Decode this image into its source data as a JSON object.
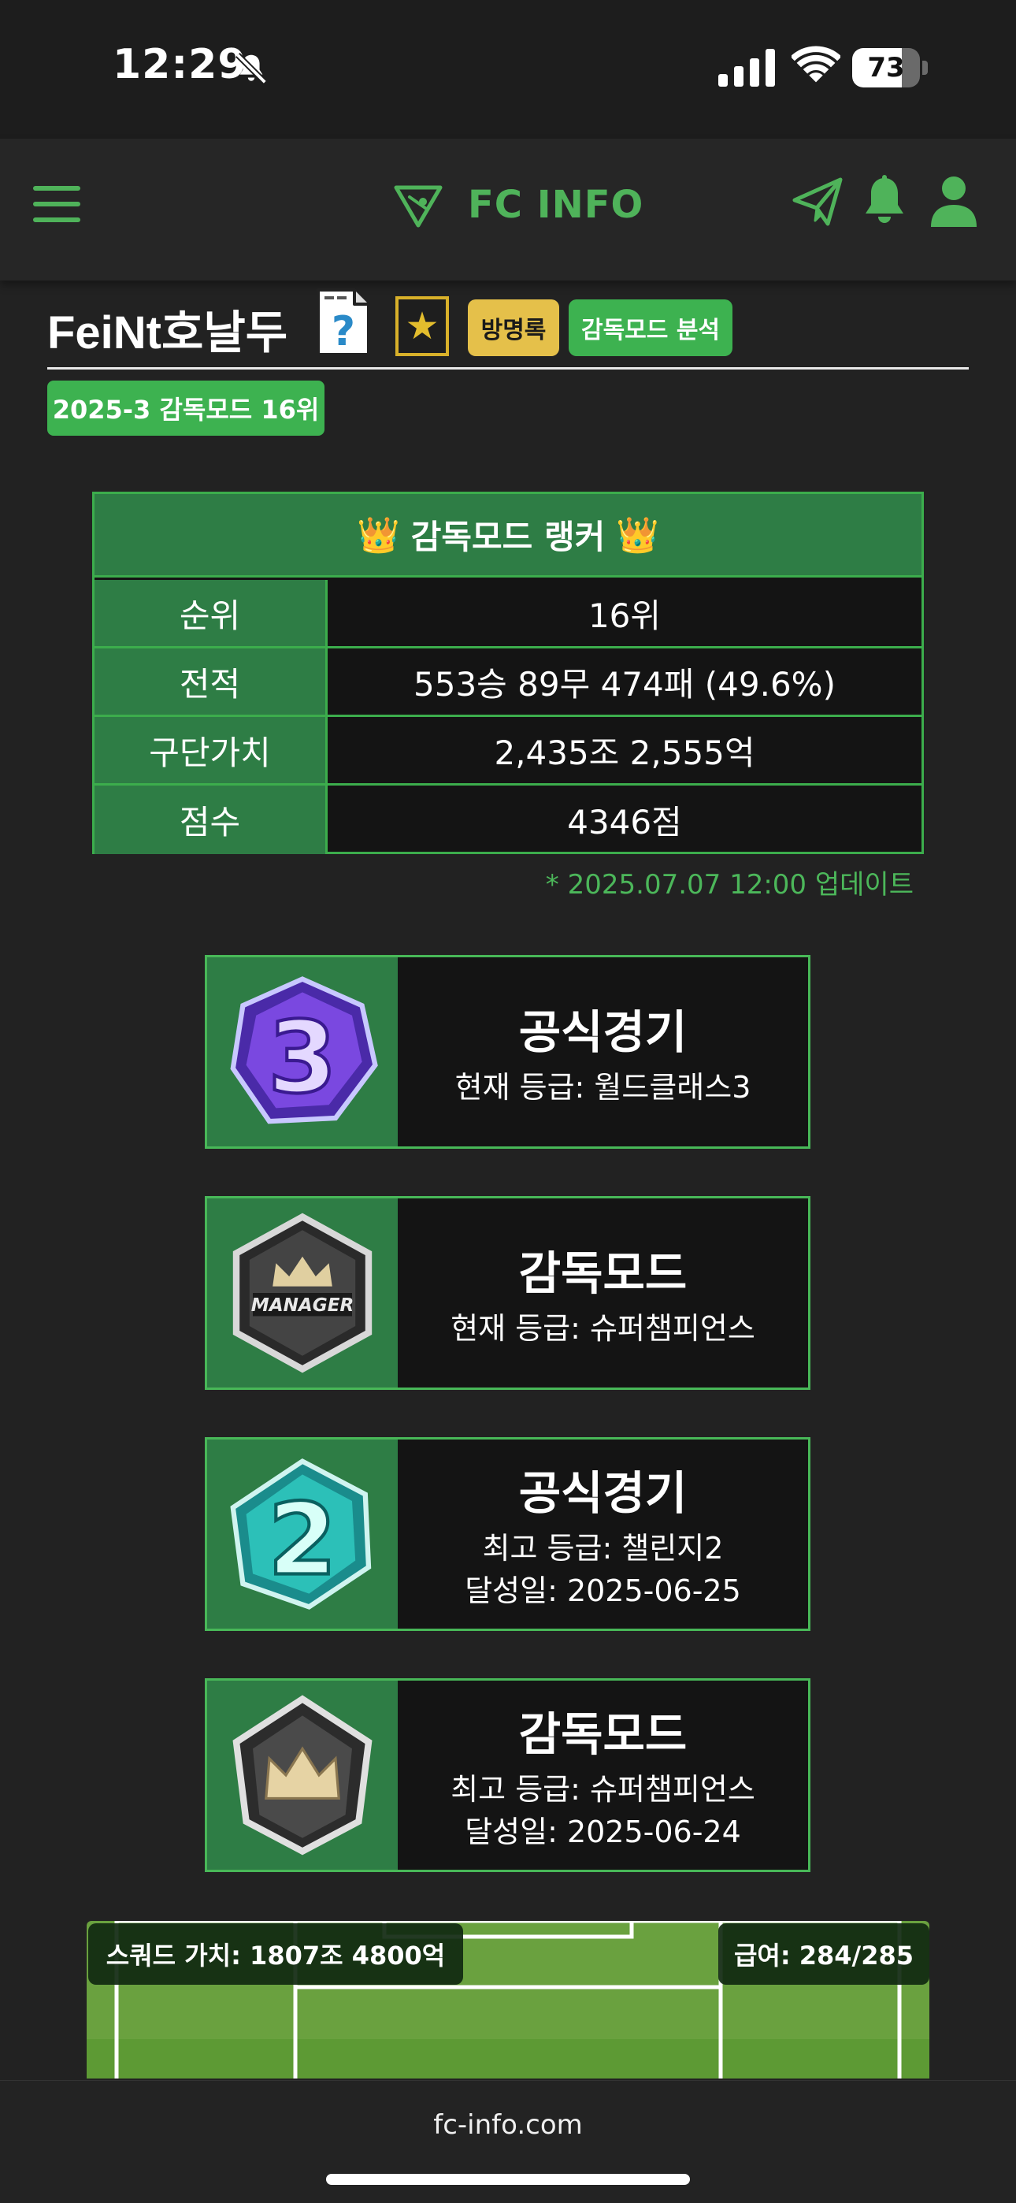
{
  "status_bar": {
    "time": "12:29",
    "battery": "73",
    "battery_level": 0.73
  },
  "nav": {
    "title": "FC INFO"
  },
  "profile": {
    "name": "FeiNt호날두",
    "guestbook_label": "방명록",
    "analysis_label": "감독모드 분석",
    "season_badge": "2025-3 감독모드 16위"
  },
  "ranker": {
    "title": "감독모드 랭커",
    "rows": [
      {
        "label": "순위",
        "value": "16위"
      },
      {
        "label": "전적",
        "value": "553승 89무 474패 (49.6%)"
      },
      {
        "label": "구단가치",
        "value": "2,435조 2,555억"
      },
      {
        "label": "점수",
        "value": "4346점"
      }
    ],
    "update_note": "* 2025.07.07 12:00 업데이트"
  },
  "cards": [
    {
      "title": "공식경기",
      "line1": "현재 등급: 월드클래스3",
      "line2": "",
      "icon": "world-class-3-badge-icon"
    },
    {
      "title": "감독모드",
      "line1": "현재 등급: 슈퍼챔피언스",
      "line2": "",
      "icon": "manager-badge-icon"
    },
    {
      "title": "공식경기",
      "line1": "최고 등급: 챌린지2",
      "line2": "달성일: 2025-06-25",
      "icon": "challenge-2-badge-icon"
    },
    {
      "title": "감독모드",
      "line1": "최고 등급: 슈퍼챔피언스",
      "line2": "달성일: 2025-06-24",
      "icon": "super-champions-badge-icon"
    }
  ],
  "squad": {
    "value_label": "스쿼드 가치: 1807조 4800억",
    "salary_label": "급여: 284/285"
  },
  "browser": {
    "url": "fc-info.com"
  },
  "colors": {
    "accent": "#4fb35a",
    "table_green": "#2e7d45",
    "gold": "#e5c04a"
  }
}
